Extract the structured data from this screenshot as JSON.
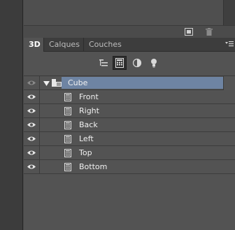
{
  "tabs": [
    {
      "label": "3D",
      "active": true
    },
    {
      "label": "Calques",
      "active": false
    },
    {
      "label": "Couches",
      "active": false
    }
  ],
  "toolbar": {
    "tools": [
      "scene-icon",
      "mesh-icon",
      "material-icon",
      "light-icon"
    ],
    "selected": "mesh-icon"
  },
  "tree": {
    "parent": {
      "label": "Cube",
      "expanded": true
    },
    "children": [
      {
        "label": "Front"
      },
      {
        "label": "Right"
      },
      {
        "label": "Back"
      },
      {
        "label": "Left"
      },
      {
        "label": "Top"
      },
      {
        "label": "Bottom"
      }
    ]
  },
  "colors": {
    "panel_bg": "#535353",
    "selection": "#6e84a3",
    "tabbar_bg": "#3d3d3d"
  }
}
